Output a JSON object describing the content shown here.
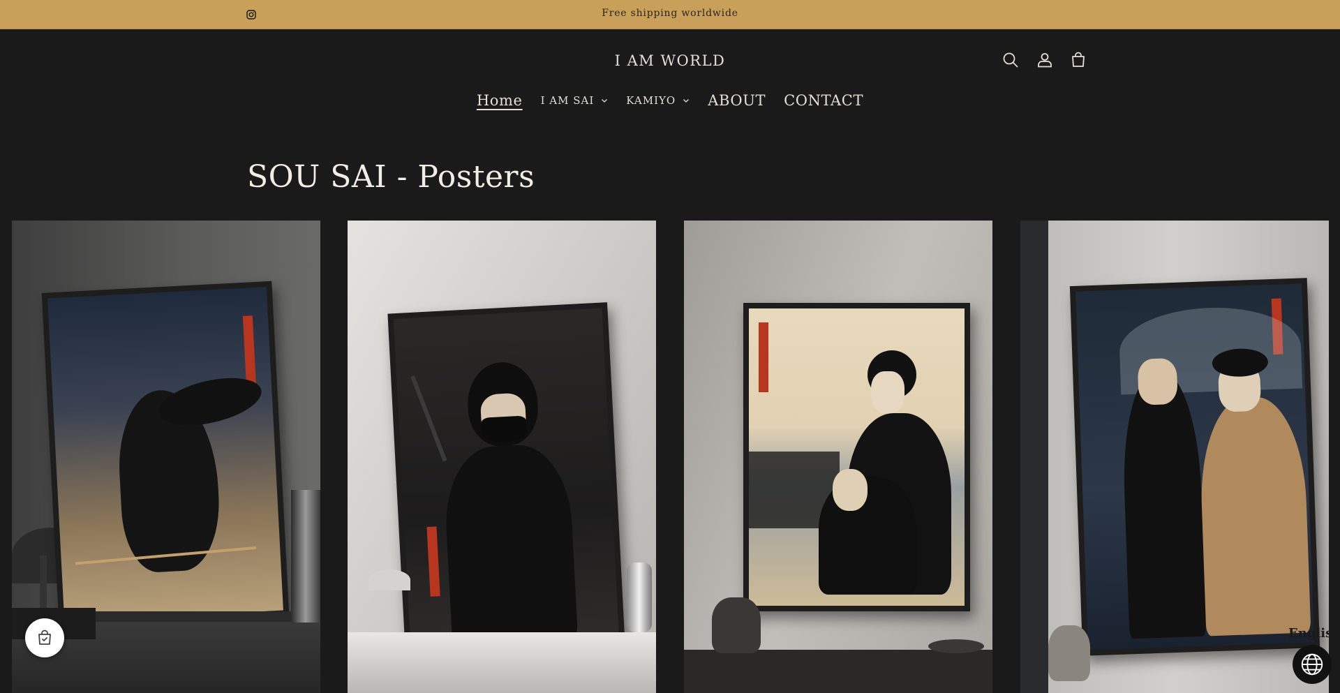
{
  "announcement": {
    "social_icon": "instagram-icon",
    "text": "Free shipping worldwide"
  },
  "header": {
    "logo": "I AM WORLD",
    "icons": [
      "search-icon",
      "account-icon",
      "cart-icon"
    ]
  },
  "nav": {
    "items": [
      {
        "label": "Home",
        "active": true,
        "dropdown": false
      },
      {
        "label": "I AM SAI",
        "active": false,
        "dropdown": true
      },
      {
        "label": "KAMIYO",
        "active": false,
        "dropdown": true
      },
      {
        "label": "ABOUT",
        "active": false,
        "dropdown": false
      },
      {
        "label": "CONTACT",
        "active": false,
        "dropdown": false
      }
    ]
  },
  "collection": {
    "title": "SOU SAI - Posters"
  },
  "widgets": {
    "chat_icon": "shopping-bag-chat-icon",
    "language_label": "English",
    "language_icon": "globe-icon"
  },
  "colors": {
    "announcement_bg": "#c9a05a",
    "page_bg": "#1a1a1a",
    "text": "#e3dfd7",
    "seal_red": "#b8361f"
  }
}
